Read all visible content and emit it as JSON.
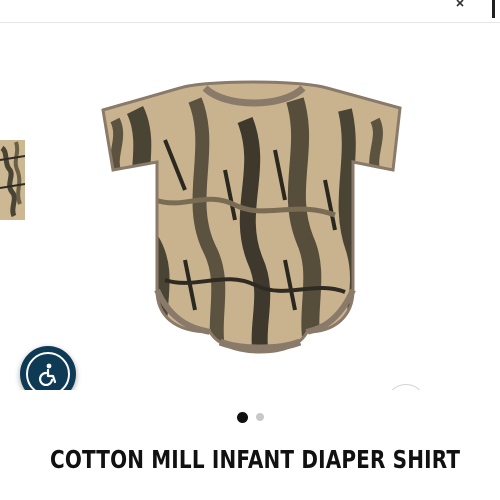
{
  "header": {
    "icon": "close-icon"
  },
  "product": {
    "title": "COTTON MILL INFANT DIAPER SHIRT",
    "gallery": {
      "image_description_icon": "onesie-image",
      "total_images": 2,
      "active_index": 0
    }
  },
  "controls": {
    "accessibility_icon": "accessibility-icon",
    "zoom_icon": "search-icon"
  },
  "colors": {
    "accessibility_button": "#0e3a56",
    "active_dot": "#111111",
    "inactive_dot": "#c8c8c8",
    "camo_base": "#c9b38f",
    "camo_dark": "#4a4434",
    "trim": "#8a7a6a"
  }
}
